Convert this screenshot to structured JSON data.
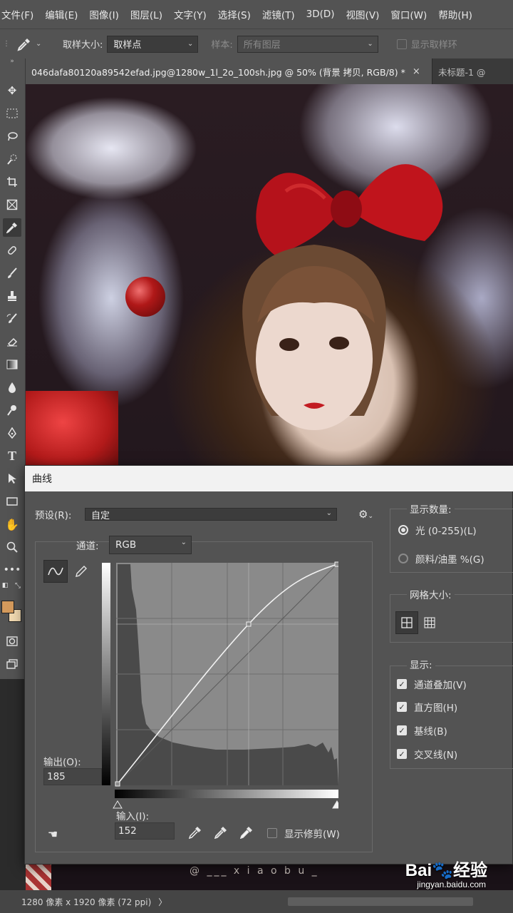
{
  "menu": [
    "文件(F)",
    "编辑(E)",
    "图像(I)",
    "图层(L)",
    "文字(Y)",
    "选择(S)",
    "滤镜(T)",
    "3D(D)",
    "视图(V)",
    "窗口(W)",
    "帮助(H)"
  ],
  "options": {
    "sample_size_label": "取样大小:",
    "sample_size_value": "取样点",
    "sample_label": "样本:",
    "sample_value": "所有图层",
    "show_ring_label": "显示取样环"
  },
  "tabs": {
    "active": "046dafa80120a89542efad.jpg@1280w_1l_2o_100sh.jpg @ 50% (背景 拷贝, RGB/8) *",
    "active_close": "×",
    "inactive": "未标题-1 @"
  },
  "canvas": {
    "watermark": "@ ___ x i a o b u _"
  },
  "dialog": {
    "title": "曲线",
    "preset_label": "预设(R):",
    "preset_value": "自定",
    "channel_label": "通道:",
    "channel_value": "RGB",
    "output_label": "输出(O):",
    "output_value": "185",
    "input_label": "输入(I):",
    "input_value": "152",
    "show_clipping": "显示修剪(W)",
    "show_amount_label": "显示数量:",
    "light_option": "光 (0-255)(L)",
    "pigment_option": "颜料/油墨 %(G)",
    "grid_size_label": "网格大小:",
    "display_label": "显示:",
    "display_options": [
      "通道叠加(V)",
      "直方图(H)",
      "基线(B)",
      "交叉线(N)"
    ]
  },
  "status": {
    "doc_size": "1280 像素 x 1920 像素 (72 ppi)",
    "arrow": "〉"
  },
  "watermark_brand": {
    "main": "Bai🐾经验",
    "sub": "jingyan.baidu.com"
  },
  "colors": {
    "foreground": "#d49a5c",
    "background": "#f0d8b0",
    "panel": "#535353"
  }
}
